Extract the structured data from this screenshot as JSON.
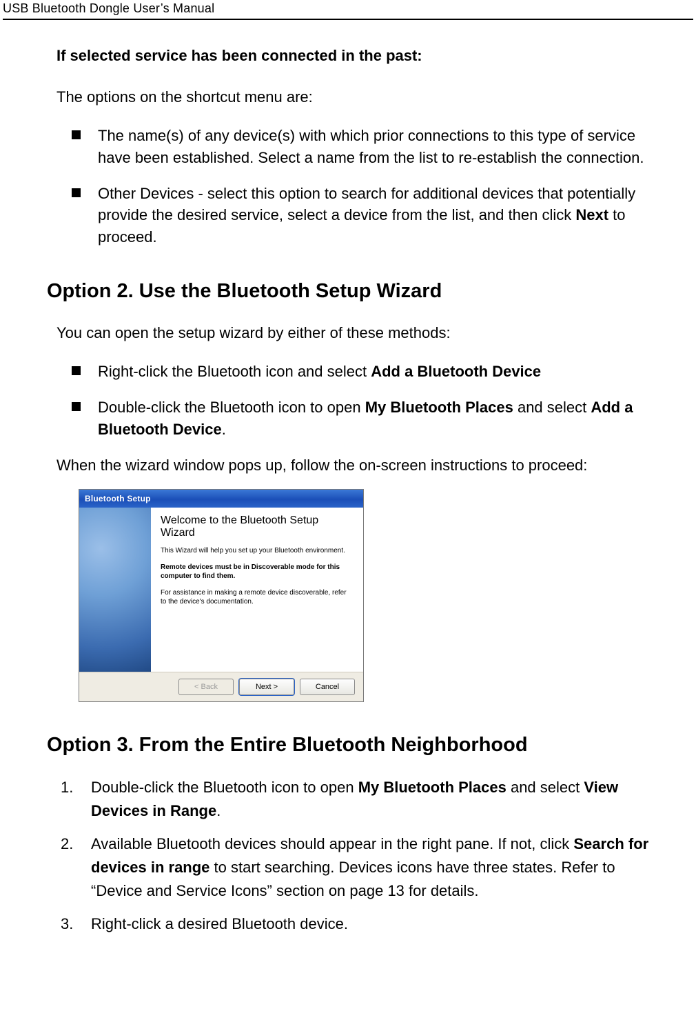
{
  "header": {
    "title": "USB Bluetooth Dongle User’s Manual"
  },
  "sec_past": {
    "heading": "If selected service has been connected in the past:",
    "intro": "The options on the shortcut menu are:",
    "items": [
      {
        "text_before": "The name(s) of any device(s) with which prior connections to this type of service have been established. Select a name from the list to re-establish the connection."
      },
      {
        "text_before": "Other Devices - select this option to search for additional devices that potentially provide the desired service, select a device from the list, and then click ",
        "bold1": "Next",
        "text_after": " to proceed."
      }
    ]
  },
  "option2": {
    "heading": "Option 2. Use the Bluetooth Setup Wizard",
    "intro": "You can open the setup wizard by either of these methods:",
    "items": [
      {
        "text_before": "Right-click the Bluetooth icon and select ",
        "bold1": "Add a Bluetooth Device"
      },
      {
        "text_before": "Double-click the Bluetooth icon to open ",
        "bold1": "My Bluetooth Places",
        "text_mid": " and select ",
        "bold2": "Add a Bluetooth Device",
        "text_after": "."
      }
    ],
    "after_list": "When the wizard window pops up, follow the on-screen instructions to proceed:"
  },
  "wizard": {
    "title": "Bluetooth Setup",
    "heading": "Welcome to the Bluetooth Setup Wizard",
    "p1": "This Wizard will help you set up your Bluetooth environment.",
    "p2": "Remote devices must be in Discoverable mode for this computer to find them.",
    "p3": "For assistance in making a remote device discoverable, refer to the device's documentation.",
    "btn_back": "< Back",
    "btn_next": "Next >",
    "btn_cancel": "Cancel"
  },
  "option3": {
    "heading": "Option 3. From the Entire Bluetooth Neighborhood",
    "items": [
      {
        "text_before": "Double-click the Bluetooth icon to open ",
        "bold1": "My Bluetooth Places",
        "text_mid": " and select ",
        "bold2": "View Devices in Range",
        "text_after": "."
      },
      {
        "text_before": "Available Bluetooth devices should appear in the right pane. If not, click ",
        "bold1": "Search for devices in range",
        "text_after": " to start searching. Devices icons have three states. Refer to “Device and Service Icons” section on page 13 for details."
      },
      {
        "text_before": "Right-click a desired Bluetooth device."
      }
    ]
  }
}
